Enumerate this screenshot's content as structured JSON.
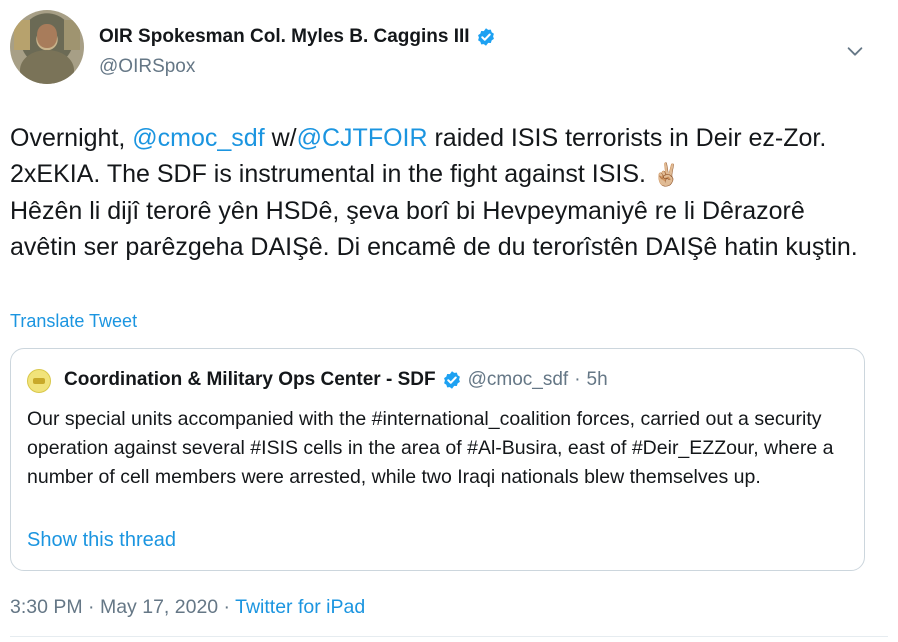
{
  "author": {
    "display_name": "OIR Spokesman Col. Myles B. Caggins III",
    "handle": "@OIRSpox",
    "avatar_icon": "avatar-photo"
  },
  "tweet": {
    "text_parts": {
      "p1": "Overnight, ",
      "m1": "@cmoc_sdf",
      "p2": " w/",
      "m2": "@CJTFOIR",
      "p3": " raided ISIS terrorists in Deir ez-Zor. 2xEKIA. The SDF is instrumental in the fight against ISIS. ",
      "emoji": "✌🏼",
      "p4": "Hêzên li dijî terorê yên HSDê, şeva borî bi Hevpeymaniyê re li Dêrazorê avêtin ser parêzgeha DAIŞê. Di encamê de du terorîstên DAIŞê hatin kuştin."
    },
    "translate_label": "Translate Tweet"
  },
  "quoted": {
    "display_name": "Coordination & Military Ops Center - SDF",
    "handle": "@cmoc_sdf",
    "separator": "·",
    "time": "5h",
    "text": "Our special units accompanied with the #international_coalition forces, carried out a security operation against several #ISIS cells in the area of #Al-Busira, east of #Deir_EZZour, where a number of cell members were arrested, while two Iraqi nationals blew themselves up.",
    "show_thread_label": "Show this thread"
  },
  "footer": {
    "time": "3:30 PM",
    "separator1": " · ",
    "date": "May 17, 2020",
    "separator2": " · ",
    "source": "Twitter for iPad"
  },
  "colors": {
    "link": "#1b95e0",
    "muted": "#657786",
    "text": "#14171a",
    "verified": "#1da1f2",
    "border": "#ccd6dd"
  }
}
